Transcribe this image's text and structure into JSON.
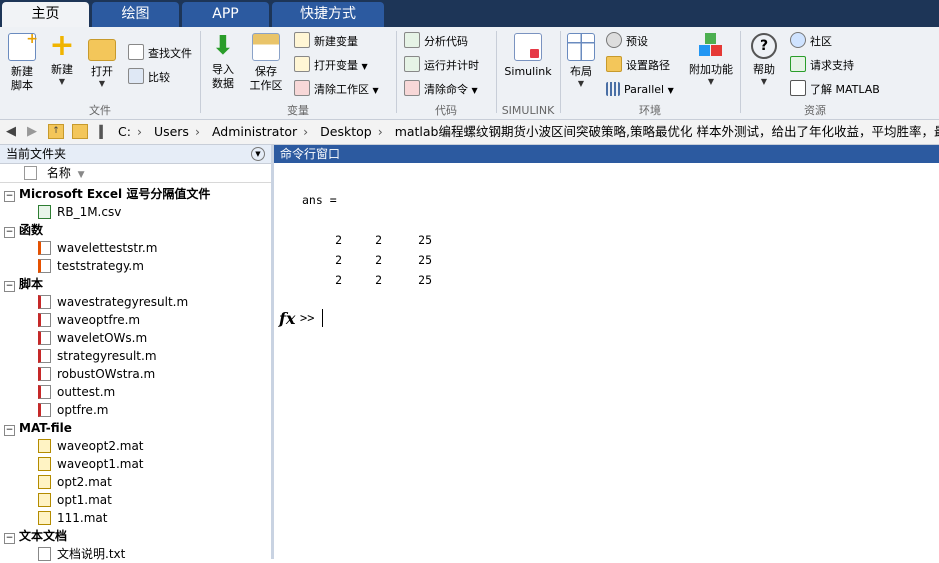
{
  "tabs": [
    "主页",
    "绘图",
    "APP",
    "快捷方式"
  ],
  "ribbon": {
    "file": {
      "label": "文件",
      "new_script": [
        "新建",
        "脚本"
      ],
      "new": "新建",
      "open": "打开",
      "find_files": "查找文件",
      "compare": "比较"
    },
    "variable": {
      "label": "变量",
      "import": [
        "导入",
        "数据"
      ],
      "save": [
        "保存",
        "工作区"
      ],
      "new_var": "新建变量",
      "open_var": "打开变量",
      "clear_ws": "清除工作区"
    },
    "code": {
      "label": "代码",
      "analyze": "分析代码",
      "run_time": "运行并计时",
      "clear_cmd": "清除命令"
    },
    "simulink": {
      "label": "SIMULINK",
      "btn": "Simulink"
    },
    "env": {
      "label": "环境",
      "layout": "布局",
      "prefs": "预设",
      "set_path": "设置路径",
      "parallel": "Parallel",
      "addons": "附加功能"
    },
    "resources": {
      "label": "资源",
      "help": "帮助",
      "community": "社区",
      "support": "请求支持",
      "learn": "了解 MATLAB"
    }
  },
  "address": [
    "C:",
    "Users",
    "Administrator",
    "Desktop",
    "matlab编程螺纹钢期货小波区间突破策略,策略最优化 样本外测试，给出了年化收益，平均胜率，最大回"
  ],
  "left_panel": {
    "title": "当前文件夹",
    "column": "名称",
    "groups": [
      {
        "name": "Microsoft Excel 逗号分隔值文件",
        "files": [
          "RB_1M.csv"
        ],
        "icon": "csv"
      },
      {
        "name": "函数",
        "files": [
          "waveletteststr.m",
          "teststrategy.m"
        ],
        "icon": "func"
      },
      {
        "name": "脚本",
        "files": [
          "wavestrategyresult.m",
          "waveoptfre.m",
          "waveletOWs.m",
          "strategyresult.m",
          "robustOWstra.m",
          "outtest.m",
          "optfre.m"
        ],
        "icon": "script"
      },
      {
        "name": "MAT-file",
        "files": [
          "waveopt2.mat",
          "waveopt1.mat",
          "opt2.mat",
          "opt1.mat",
          "111.mat"
        ],
        "icon": "mat"
      },
      {
        "name": "文本文档",
        "files": [
          "文档说明.txt"
        ],
        "icon": "txt"
      }
    ]
  },
  "command_window": {
    "title": "命令行窗口",
    "output_var": "ans =",
    "matrix": [
      [
        "2",
        "2",
        "25"
      ],
      [
        "2",
        "2",
        "25"
      ],
      [
        "2",
        "2",
        "25"
      ]
    ],
    "prompt": ">>",
    "fx": "fx"
  },
  "colors": {
    "tabbar": "#1d3557",
    "tab": "#2c5aa0",
    "accent": "#2c5aa0"
  }
}
